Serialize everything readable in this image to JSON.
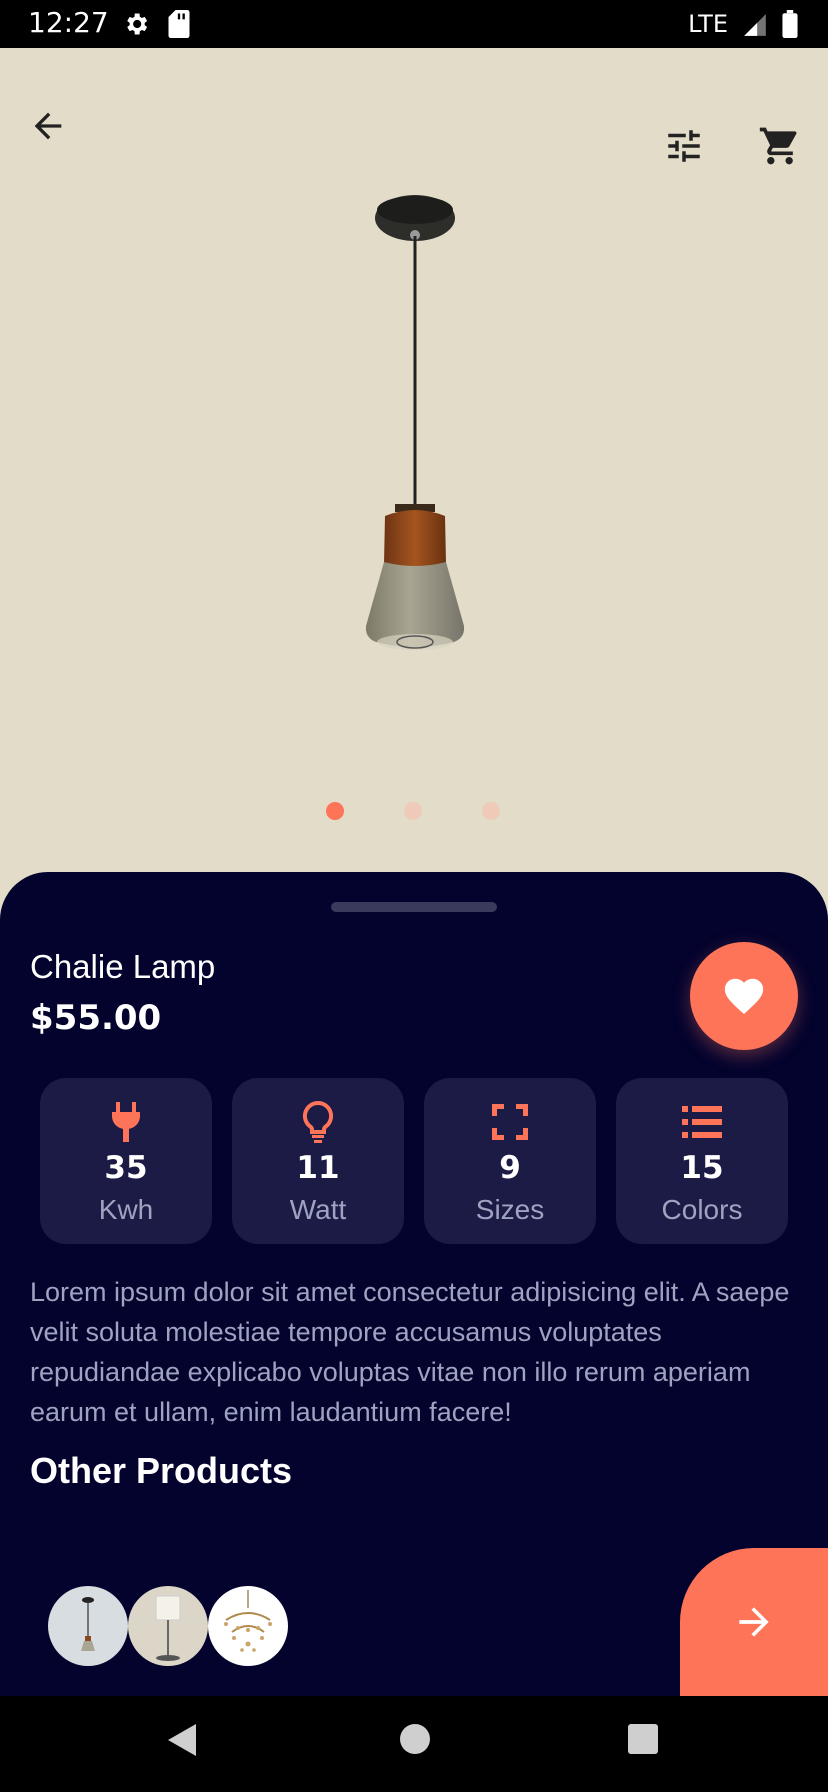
{
  "status_bar": {
    "time": "12:27",
    "network": "LTE",
    "icons": [
      "gear-icon",
      "sd-card-icon",
      "signal-icon",
      "battery-icon"
    ]
  },
  "header": {
    "icons": [
      "back-arrow-icon",
      "tune-filter-icon",
      "shopping-cart-icon"
    ]
  },
  "carousel": {
    "page_count": 3,
    "active_index": 0
  },
  "product": {
    "name": "Chalie Lamp",
    "price": "$55.00",
    "favorite": true,
    "specs": [
      {
        "icon": "plug-icon",
        "value": "35",
        "label": "Kwh"
      },
      {
        "icon": "lightbulb-icon",
        "value": "11",
        "label": "Watt"
      },
      {
        "icon": "fullscreen-frame-icon",
        "value": "9",
        "label": "Sizes"
      },
      {
        "icon": "list-icon",
        "value": "15",
        "label": "Colors"
      }
    ],
    "description": "Lorem ipsum dolor sit amet consectetur adipisicing elit. A saepe velit soluta molestiae tempore accusamus voluptates repudiandae explicabo voluptas vitae non illo rerum aperiam earum et ullam, enim laudantium facere!"
  },
  "other_products": {
    "title": "Other Products",
    "thumbnails": [
      "pendant-lamp-thumbnail",
      "floor-lamp-thumbnail",
      "chandelier-thumbnail"
    ]
  },
  "colors": {
    "accent": "#fe7459",
    "sheet_background": "#03032e",
    "card_background": "#1b1b46",
    "muted_text": "#9ea3c0",
    "top_background": "#e2dcc8"
  }
}
